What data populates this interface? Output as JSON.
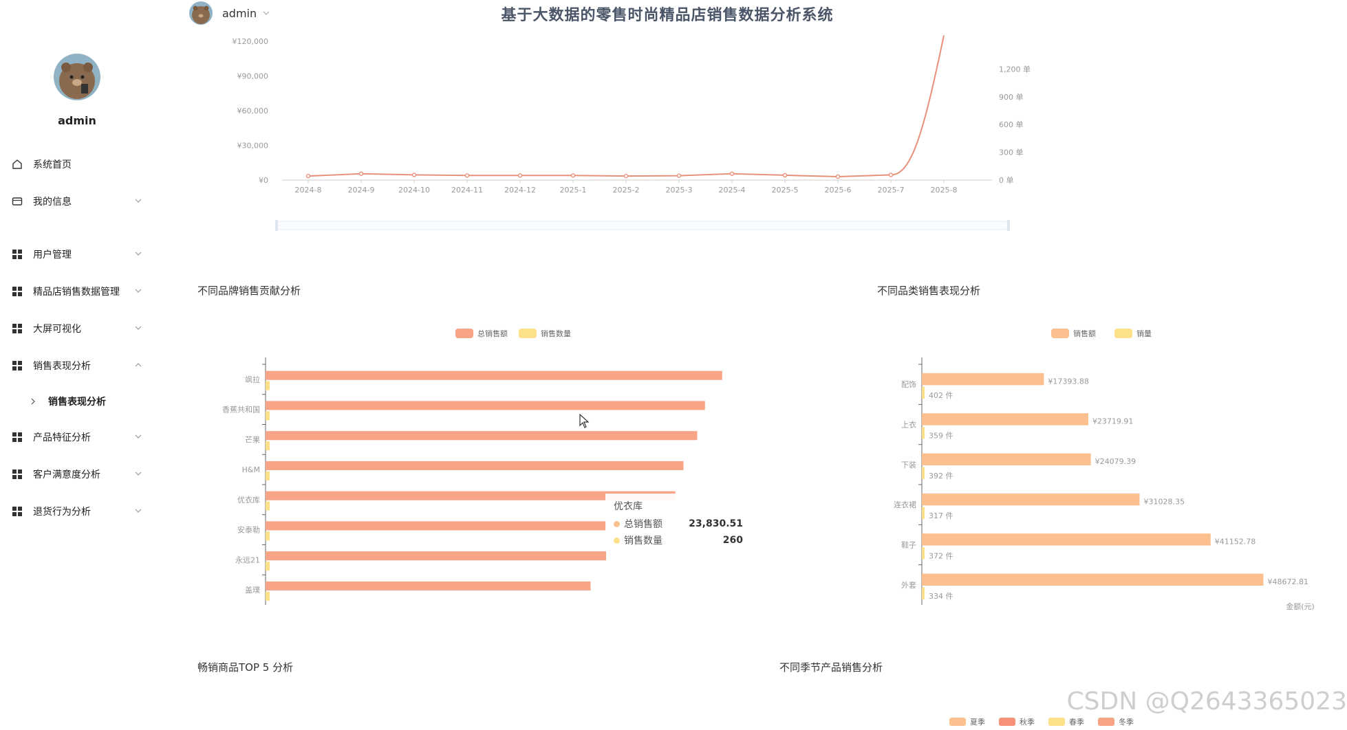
{
  "header": {
    "username": "admin",
    "title": "基于大数据的零售时尚精品店销售数据分析系统"
  },
  "sidebar": {
    "username": "admin",
    "items": [
      {
        "label": "系统首页",
        "icon": "home-icon"
      },
      {
        "label": "我的信息",
        "icon": "wallet-icon"
      },
      {
        "label": "用户管理",
        "icon": "grid-icon"
      },
      {
        "label": "精品店销售数据管理",
        "icon": "grid-icon"
      },
      {
        "label": "大屏可视化",
        "icon": "grid-icon"
      },
      {
        "label": "销售表现分析",
        "icon": "grid-icon"
      },
      {
        "label": "产品特征分析",
        "icon": "grid-icon"
      },
      {
        "label": "客户满意度分析",
        "icon": "grid-icon"
      },
      {
        "label": "退货行为分析",
        "icon": "grid-icon"
      }
    ],
    "sub_item": "销售表现分析"
  },
  "sections": {
    "brand": "不同品牌销售贡献分析",
    "category": "不同品类销售表现分析",
    "top5": "畅销商品TOP 5 分析",
    "season": "不同季节产品销售分析"
  },
  "tooltip": {
    "title": "优衣库",
    "row1_label": "总销售额",
    "row1_value": "23,830.51",
    "row2_label": "销售数量",
    "row2_value": "260"
  },
  "watermark": "CSDN @Q2643365023",
  "colors": {
    "line": "#e8907a",
    "bar_salmon": "#f7a487",
    "bar_yellow": "#fde08a",
    "bar_peach": "#fbc08d",
    "accent_title": "#4a5568"
  },
  "chart_data": [
    {
      "type": "line",
      "x": [
        "2024-8",
        "2024-9",
        "2024-10",
        "2024-11",
        "2024-12",
        "2025-1",
        "2025-2",
        "2025-3",
        "2025-4",
        "2025-5",
        "2025-6",
        "2025-7",
        "2025-8"
      ],
      "y_left_ticks": [
        "¥0",
        "¥30,000",
        "¥60,000",
        "¥90,000",
        "¥120,000"
      ],
      "y_right_ticks": [
        "0 单",
        "300 单",
        "600 单",
        "900 单",
        "1,200 单"
      ],
      "ylim_left": [
        0,
        120000
      ],
      "ylim_right": [
        0,
        1500
      ],
      "series": [
        {
          "values": [
            3500,
            5500,
            4500,
            4000,
            4000,
            4000,
            3500,
            3800,
            5500,
            4200,
            3000,
            4500,
            125000
          ]
        }
      ],
      "grid": false
    },
    {
      "type": "bar",
      "orientation": "horizontal",
      "categories": [
        "盖璞",
        "永远21",
        "安泰勒",
        "优衣库",
        "H&M",
        "芒果",
        "香蕉共和国",
        "飒拉"
      ],
      "series": [
        {
          "name": "总销售额",
          "values": [
            18900,
            19800,
            19800,
            23830.51,
            24300,
            25100,
            25550,
            26550
          ]
        },
        {
          "name": "销售数量",
          "values": [
            250,
            255,
            255,
            260,
            275,
            285,
            290,
            310
          ]
        }
      ],
      "x_ticks": [
        "0",
        "5,000",
        "10,000",
        "15,000",
        "20,000",
        "25,000",
        "30,000"
      ],
      "xlim": [
        0,
        30000
      ],
      "legend": "top-center"
    },
    {
      "type": "bar",
      "orientation": "horizontal",
      "categories": [
        "外套",
        "鞋子",
        "连衣裙",
        "下装",
        "上衣",
        "配饰"
      ],
      "series": [
        {
          "name": "销售额",
          "values": [
            48672.81,
            41152.78,
            31028.35,
            24079.39,
            23719.91,
            17393.88
          ],
          "labels": [
            "¥48672.81",
            "¥41152.78",
            "¥31028.35",
            "¥24079.39",
            "¥23719.91",
            "¥17393.88"
          ]
        },
        {
          "name": "销量",
          "values": [
            334,
            372,
            317,
            392,
            359,
            402
          ],
          "labels": [
            "334 件",
            "372 件",
            "317 件",
            "392 件",
            "359 件",
            "402 件"
          ]
        }
      ],
      "x_ticks": [
        "0",
        "10,000",
        "20,000",
        "30,000",
        "40,000",
        "50,000"
      ],
      "xlim": [
        0,
        50000
      ],
      "xlabel": "金额(元)",
      "legend": "top-center"
    },
    {
      "type": "pie",
      "legend": [
        "夏季",
        "秋季",
        "春季",
        "冬季"
      ],
      "legend_colors": [
        "#fbc08d",
        "#f7917a",
        "#fde08a",
        "#f7a487"
      ]
    }
  ]
}
